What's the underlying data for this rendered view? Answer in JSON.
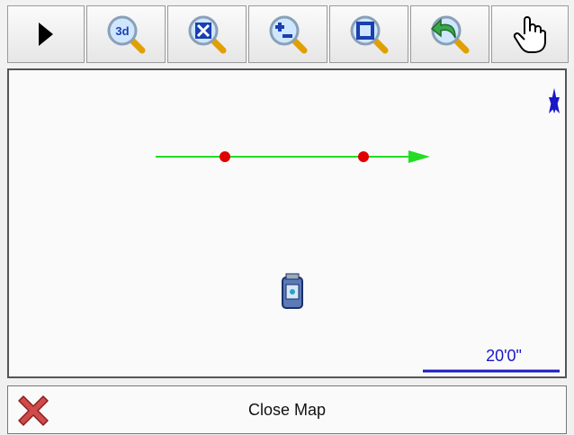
{
  "toolbar": {
    "buttons": [
      {
        "name": "menu-arrow",
        "icon": "play-triangle-icon"
      },
      {
        "name": "view-3d",
        "icon": "zoom-3d-icon",
        "icon_text": "3d"
      },
      {
        "name": "zoom-extents",
        "icon": "zoom-extents-icon"
      },
      {
        "name": "zoom-in-out",
        "icon": "zoom-in-out-icon"
      },
      {
        "name": "zoom-window",
        "icon": "zoom-window-icon"
      },
      {
        "name": "zoom-previous",
        "icon": "zoom-previous-icon"
      },
      {
        "name": "pan",
        "icon": "hand-pan-icon"
      }
    ]
  },
  "map": {
    "north_icon": "north-arrow-icon",
    "line_color": "#22dd22",
    "point_color": "#e00000",
    "instrument_icon": "total-station-icon",
    "scale_label": "20'0\"",
    "scale_color": "#1818c8"
  },
  "footer": {
    "close_label": "Close Map",
    "close_icon": "red-x-icon"
  }
}
